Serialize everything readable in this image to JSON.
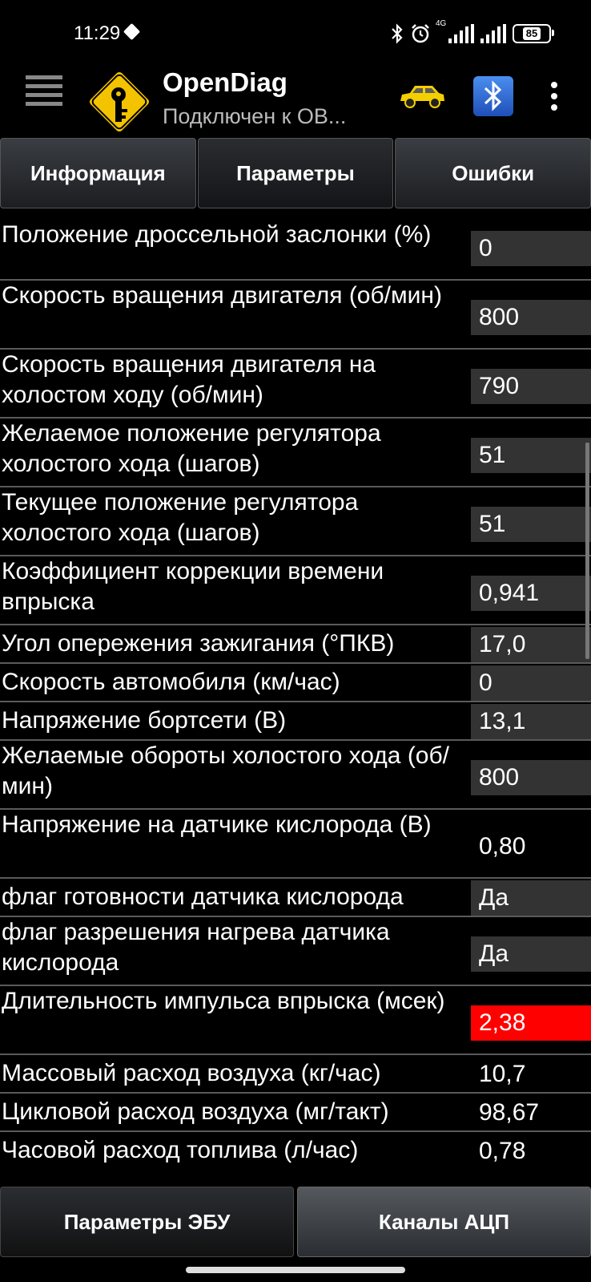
{
  "status_bar": {
    "time": "11:29",
    "network": "4G",
    "battery": "85"
  },
  "app": {
    "title": "OpenDiag",
    "subtitle": "Подключен к ОВ..."
  },
  "tabs": [
    {
      "label": "Информация"
    },
    {
      "label": "Параметры"
    },
    {
      "label": "Ошибки"
    }
  ],
  "params": [
    {
      "label": "Положение дроссельной заслонки (%)",
      "value": "0"
    },
    {
      "label": "Скорость вращения двигателя (об/мин)",
      "value": "800"
    },
    {
      "label": "Скорость вращения двигателя на холостом ходу (об/мин)",
      "value": "790"
    },
    {
      "label": "Желаемое положение регулятора холостого хода (шагов)",
      "value": "51"
    },
    {
      "label": "Текущее положение регулятора холостого хода (шагов)",
      "value": "51"
    },
    {
      "label": "Коэффициент коррекции времени впрыска",
      "value": "0,941"
    },
    {
      "label": "Угол опережения зажигания (°ПКВ)",
      "value": "17,0"
    },
    {
      "label": "Скорость автомобиля (км/час)",
      "value": "0"
    },
    {
      "label": "Напряжение бортсети (В)",
      "value": "13,1"
    },
    {
      "label": "Желаемые обороты холостого хода (об/мин)",
      "value": "800"
    },
    {
      "label": "Напряжение на датчике кислорода (В)",
      "value": "0,80"
    },
    {
      "label": "флаг готовности датчика кислорода",
      "value": "Да"
    },
    {
      "label": "флаг разрешения нагрева датчика кислорода",
      "value": "Да"
    },
    {
      "label": "Длительность импульса впрыска (мсек)",
      "value": "2,38"
    },
    {
      "label": "Массовый расход воздуха (кг/час)",
      "value": "10,7"
    },
    {
      "label": "Цикловой расход воздуха (мг/такт)",
      "value": "98,67"
    },
    {
      "label": "Часовой расход топлива (л/час)",
      "value": "0,78"
    }
  ],
  "bottom_tabs": [
    {
      "label": "Параметры ЭБУ"
    },
    {
      "label": "Каналы АЦП"
    }
  ],
  "colors": {
    "alert": "#ff0000",
    "value_bg": "#333333"
  }
}
